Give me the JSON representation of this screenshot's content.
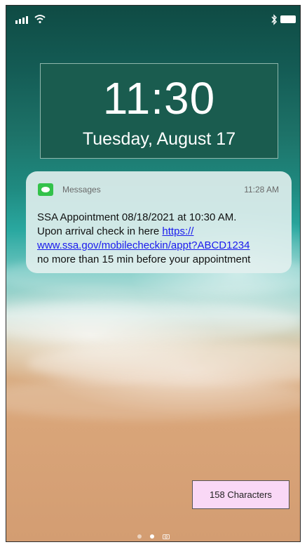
{
  "clock": {
    "time": "11:30",
    "date": "Tuesday, August 17"
  },
  "notification": {
    "app": "Messages",
    "time": "11:28 AM",
    "text_line1": "SSA Appointment 08/18/2021 at 10:30 AM.",
    "text_before_link": "Upon arrival check in here ",
    "link_part1": "https://",
    "link_part2": "www.ssa.gov/mobilecheckin/appt?ABCD1234",
    "text_after_link": "no more than 15 min before your appointment",
    "app_icon": "messages-icon"
  },
  "char_count": {
    "label": "158 Characters"
  },
  "status_bar": {
    "icons": [
      "signal-icon",
      "wifi-icon",
      "bluetooth-icon",
      "battery-icon"
    ]
  },
  "page_indicator": {
    "pages": 2,
    "active": 1,
    "extra_icon": "camera-icon"
  }
}
